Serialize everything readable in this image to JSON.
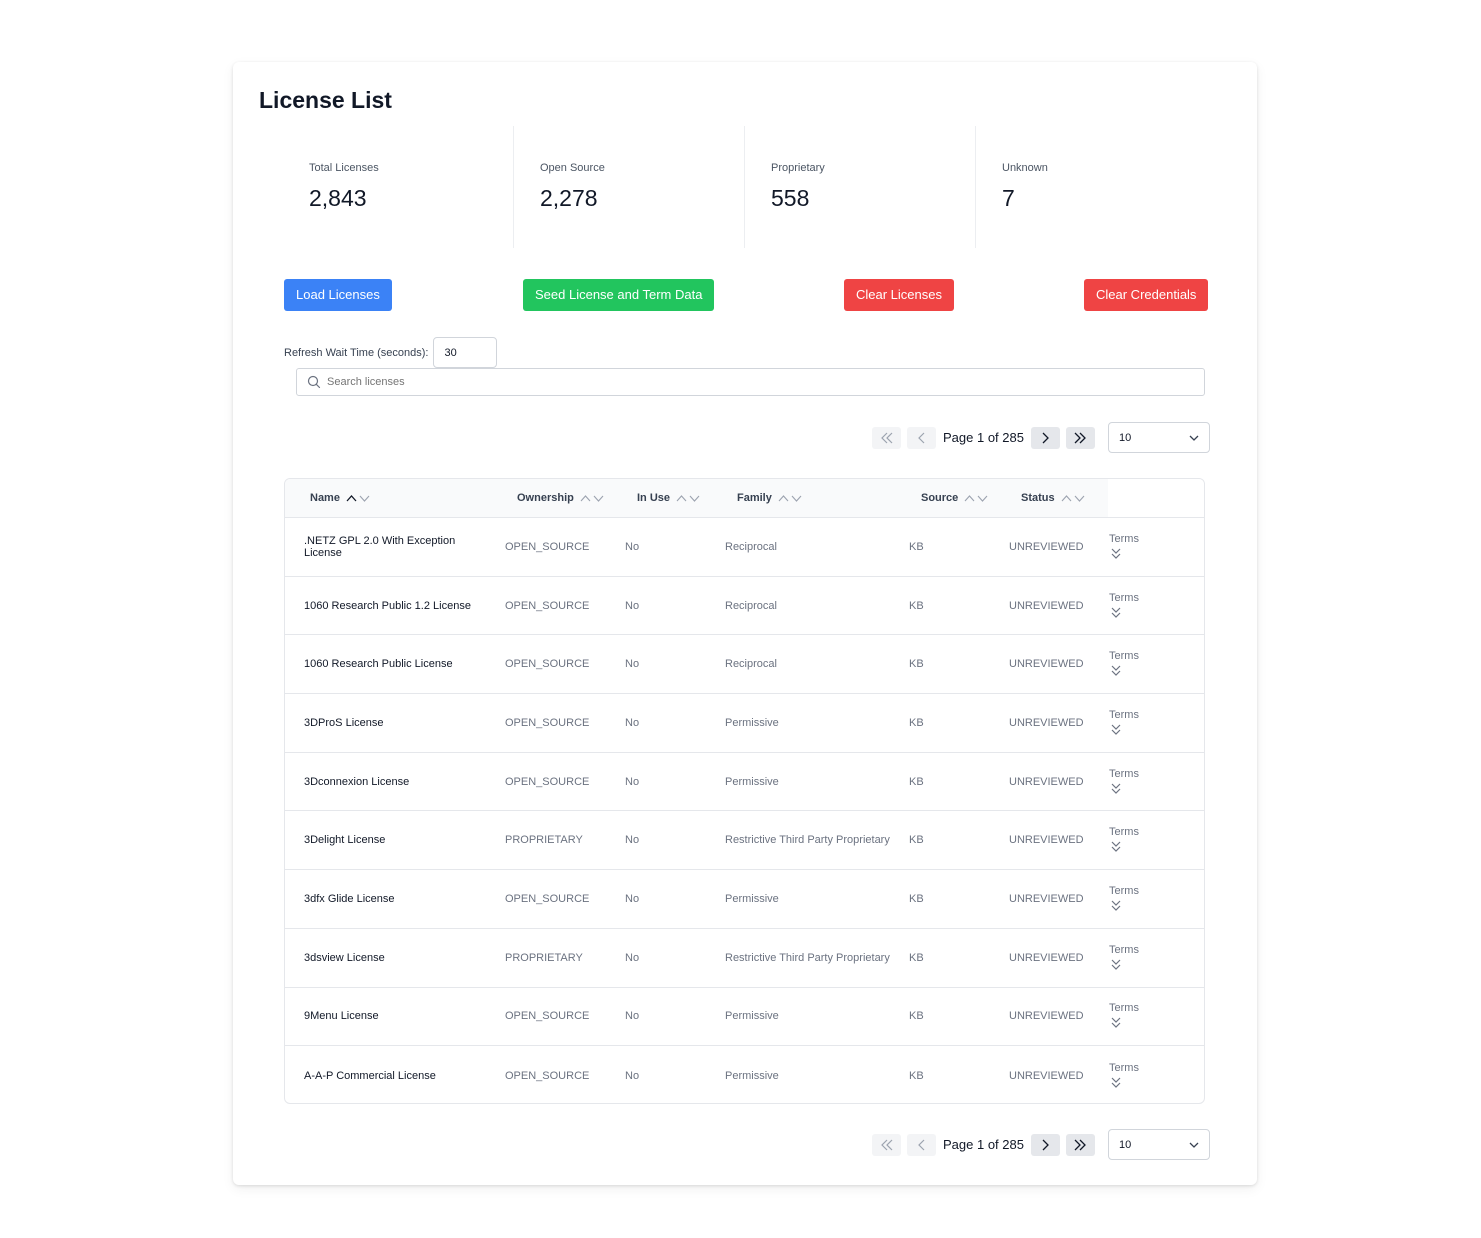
{
  "page": {
    "title": "License List"
  },
  "stats": [
    {
      "label": "Total Licenses",
      "value": "2,843"
    },
    {
      "label": "Open Source",
      "value": "2,278"
    },
    {
      "label": "Proprietary",
      "value": "558"
    },
    {
      "label": "Unknown",
      "value": "7"
    }
  ],
  "buttons": {
    "load": "Load Licenses",
    "seed": "Seed License and Term Data",
    "clear_licenses": "Clear Licenses",
    "clear_credentials": "Clear Credentials"
  },
  "colors": {
    "blue": "#3b82f6",
    "green": "#22c55e",
    "red": "#ef4444"
  },
  "refresh": {
    "label": "Refresh Wait Time (seconds):",
    "value": "30"
  },
  "search": {
    "placeholder": "Search licenses"
  },
  "pagination": {
    "text": "Page 1 of 285",
    "page_size": "10"
  },
  "table": {
    "columns": [
      "Name",
      "Ownership",
      "In Use",
      "Family",
      "Source",
      "Status"
    ],
    "terms_label": "Terms",
    "rows": [
      {
        "name": ".NETZ GPL 2.0 With Exception License",
        "ownership": "OPEN_SOURCE",
        "in_use": "No",
        "family": "Reciprocal",
        "source": "KB",
        "status": "UNREVIEWED"
      },
      {
        "name": "1060 Research Public 1.2 License",
        "ownership": "OPEN_SOURCE",
        "in_use": "No",
        "family": "Reciprocal",
        "source": "KB",
        "status": "UNREVIEWED"
      },
      {
        "name": "1060 Research Public License",
        "ownership": "OPEN_SOURCE",
        "in_use": "No",
        "family": "Reciprocal",
        "source": "KB",
        "status": "UNREVIEWED"
      },
      {
        "name": "3DProS License",
        "ownership": "OPEN_SOURCE",
        "in_use": "No",
        "family": "Permissive",
        "source": "KB",
        "status": "UNREVIEWED"
      },
      {
        "name": "3Dconnexion License",
        "ownership": "OPEN_SOURCE",
        "in_use": "No",
        "family": "Permissive",
        "source": "KB",
        "status": "UNREVIEWED"
      },
      {
        "name": "3Delight License",
        "ownership": "PROPRIETARY",
        "in_use": "No",
        "family": "Restrictive Third Party Proprietary",
        "source": "KB",
        "status": "UNREVIEWED"
      },
      {
        "name": "3dfx Glide License",
        "ownership": "OPEN_SOURCE",
        "in_use": "No",
        "family": "Permissive",
        "source": "KB",
        "status": "UNREVIEWED"
      },
      {
        "name": "3dsview License",
        "ownership": "PROPRIETARY",
        "in_use": "No",
        "family": "Restrictive Third Party Proprietary",
        "source": "KB",
        "status": "UNREVIEWED"
      },
      {
        "name": "9Menu License",
        "ownership": "OPEN_SOURCE",
        "in_use": "No",
        "family": "Permissive",
        "source": "KB",
        "status": "UNREVIEWED"
      },
      {
        "name": "A-A-P Commercial License",
        "ownership": "OPEN_SOURCE",
        "in_use": "No",
        "family": "Permissive",
        "source": "KB",
        "status": "UNREVIEWED"
      }
    ]
  }
}
